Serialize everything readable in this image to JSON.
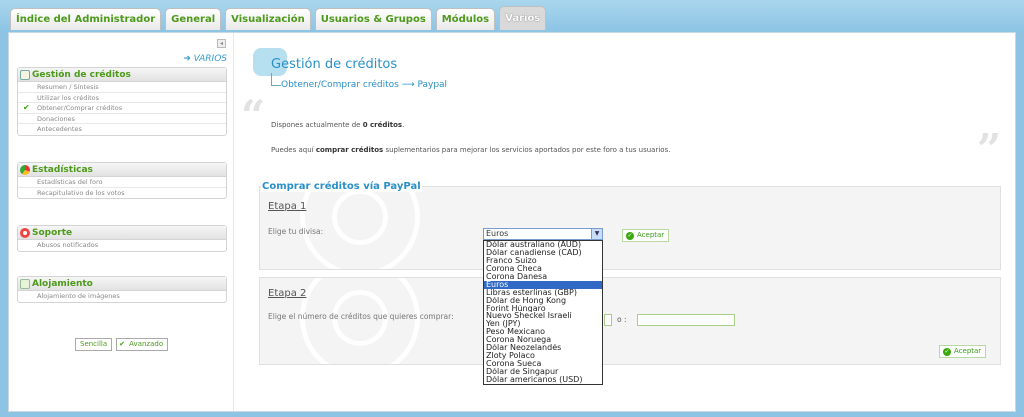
{
  "tabs": [
    {
      "label": "Índice del Administrador",
      "active": false
    },
    {
      "label": "General",
      "active": false
    },
    {
      "label": "Visualización",
      "active": false
    },
    {
      "label": "Usuarios & Grupos",
      "active": false
    },
    {
      "label": "Módulos",
      "active": false
    },
    {
      "label": "Varios",
      "active": true
    }
  ],
  "sidebar": {
    "section_link": "➜ VARIOS",
    "boxes": [
      {
        "title": "Gestión de créditos",
        "icon": "credits-icon",
        "items": [
          {
            "label": "Resumen / Síntesis",
            "checked": false
          },
          {
            "label": "Utilizar los créditos",
            "checked": false
          },
          {
            "label": "Obtener/Comprar créditos",
            "checked": true
          },
          {
            "label": "Donaciones",
            "checked": false
          },
          {
            "label": "Antecedentes",
            "checked": false
          }
        ]
      },
      {
        "title": "Estadísticas",
        "icon": "pie-chart-icon",
        "items": [
          {
            "label": "Estadísticas del foro"
          },
          {
            "label": "Recapitulativo de los votos"
          }
        ]
      },
      {
        "title": "Soporte",
        "icon": "lifebuoy-icon",
        "items": [
          {
            "label": "Abusos notificados"
          }
        ]
      },
      {
        "title": "Alojamiento",
        "icon": "hosting-icon",
        "items": [
          {
            "label": "Alojamiento de imágenes"
          }
        ]
      }
    ],
    "mode_buttons": {
      "simple": "Sencilla",
      "advanced": "Avanzado"
    }
  },
  "main": {
    "title": "Gestión de créditos",
    "breadcrumb": {
      "part1": "Obtener/Comprar créditos",
      "sep": "⟶",
      "part2": "Paypal"
    },
    "balance_text_pre": "Dispones actualmente de ",
    "balance_value": "0 créditos",
    "balance_text_post": ".",
    "info_pre": "Puedes aquí ",
    "info_bold": "comprar créditos",
    "info_post": " suplementarios para mejorar los servicios aportados por este foro a tus usuarios.",
    "section_title": "Comprar créditos vía PayPal",
    "step1": {
      "title": "Etapa 1",
      "label": "Elige tu divisa:",
      "selected": "Euros",
      "accept": "Aceptar"
    },
    "step2": {
      "title": "Etapa 2",
      "label": "Elige el número de créditos que quieres comprar:",
      "or": "o :",
      "accept": "Aceptar"
    },
    "currency_options": [
      "Dólar australiano (AUD)",
      "Dólar canadiense (CAD)",
      "Franco Suizo",
      "Corona Checa",
      "Corona Danesa",
      "Euros",
      "Libras esterlinas (GBP)",
      "Dólar de Hong Kong",
      "Forint Húngaro",
      "Nuevo Sheckel Israelí",
      "Yen (JPY)",
      "Peso Mexicano",
      "Corona Noruega",
      "Dólar Neozelandés",
      "Zloty Polaco",
      "Corona Sueca",
      "Dólar de Singapur",
      "Dólar americanos (USD)"
    ],
    "selected_index": 5
  }
}
